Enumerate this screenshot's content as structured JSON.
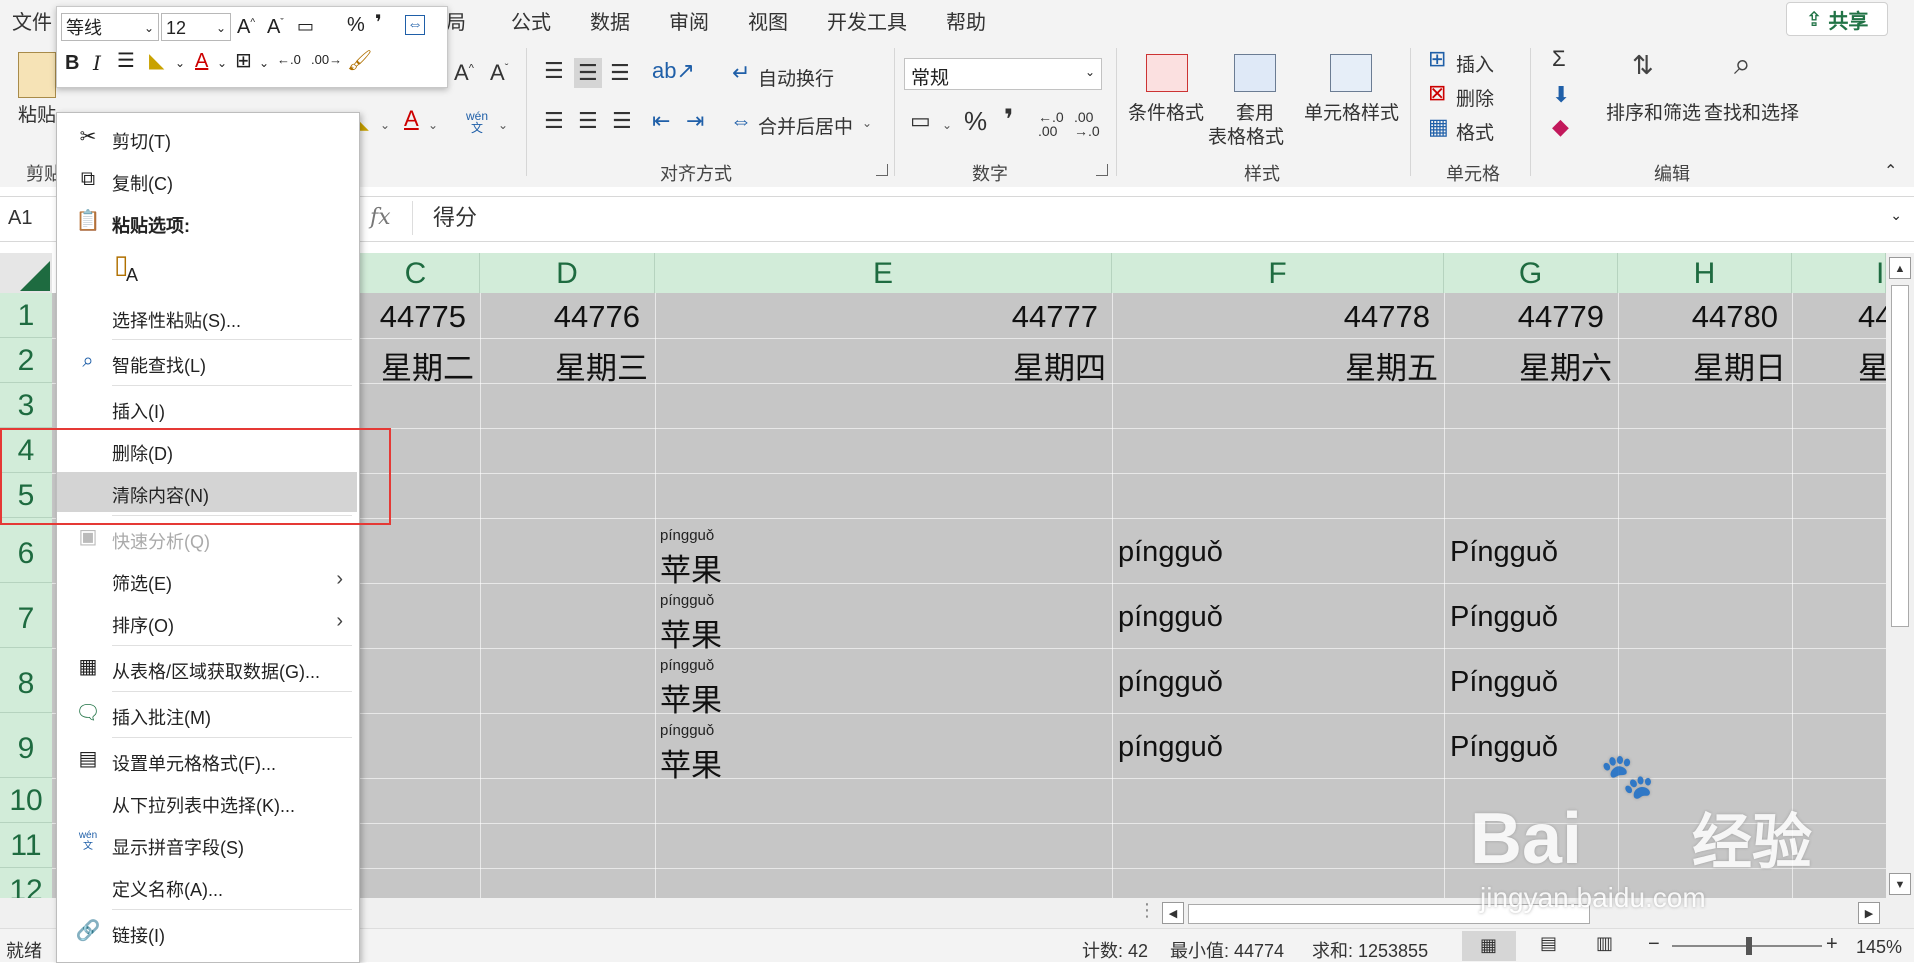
{
  "menubar": {
    "items": [
      "文件",
      "公式",
      "数据",
      "审阅",
      "视图",
      "开发工具",
      "帮助"
    ],
    "partial_item": "局",
    "share_label": "共享"
  },
  "mini_toolbar": {
    "font_name": "等线",
    "font_size": "12",
    "bold": "B",
    "italic": "I"
  },
  "ribbon": {
    "clipboard": {
      "paste_label": "粘贴",
      "group_label": "剪贴"
    },
    "alignment": {
      "wrap_text": "自动换行",
      "merge_center": "合并后居中",
      "group_label": "对齐方式",
      "pinyin_top": "wén",
      "pinyin_bottom": "文"
    },
    "number": {
      "format_value": "常规",
      "group_label": "数字"
    },
    "styles": {
      "conditional": "条件格式",
      "table_fmt_1": "套用",
      "table_fmt_2": "表格格式",
      "cell_styles": "单元格样式",
      "group_label": "样式"
    },
    "cells": {
      "insert": "插入",
      "delete": "删除",
      "format": "格式",
      "group_label": "单元格"
    },
    "editing": {
      "sort_filter": "排序和筛选",
      "find_select": "查找和选择",
      "group_label": "编辑"
    }
  },
  "formula_bar": {
    "name_box": "A1",
    "fx": "fx",
    "content": "得分"
  },
  "columns": [
    "C",
    "D",
    "E",
    "F",
    "G",
    "H",
    "I"
  ],
  "rows": [
    "1",
    "2",
    "3",
    "4",
    "5",
    "6",
    "7",
    "8",
    "9",
    "10",
    "11",
    "12"
  ],
  "cells": {
    "row1": [
      "44775",
      "44776",
      "44777",
      "44778",
      "44779",
      "44780",
      "44"
    ],
    "row2": [
      "星期二",
      "星期三",
      "星期四",
      "星期五",
      "星期六",
      "星期日",
      "星"
    ],
    "pinyin_small": "píngguǒ",
    "hanzi": "苹果",
    "col_f": "píngguǒ",
    "col_g": "Píngguǒ"
  },
  "context_menu": {
    "items": [
      {
        "label": "剪切(T)",
        "icon": "scissors-icon"
      },
      {
        "label": "复制(C)",
        "icon": "copy-icon"
      },
      {
        "label": "粘贴选项:",
        "icon": "paste-icon"
      },
      {
        "label": "选择性粘贴(S)..."
      },
      {
        "label": "智能查找(L)",
        "icon": "smart-lookup-icon"
      },
      {
        "label": "插入(I)"
      },
      {
        "label": "删除(D)"
      },
      {
        "label": "清除内容(N)"
      },
      {
        "label": "快速分析(Q)",
        "icon": "quick-analysis-icon",
        "disabled": true
      },
      {
        "label": "筛选(E)",
        "submenu": true
      },
      {
        "label": "排序(O)",
        "submenu": true
      },
      {
        "label": "从表格/区域获取数据(G)...",
        "icon": "table-icon"
      },
      {
        "label": "插入批注(M)",
        "icon": "comment-icon"
      },
      {
        "label": "设置单元格格式(F)...",
        "icon": "format-cells-icon"
      },
      {
        "label": "从下拉列表中选择(K)..."
      },
      {
        "label": "显示拼音字段(S)",
        "icon": "pinyin-icon"
      },
      {
        "label": "定义名称(A)..."
      },
      {
        "label": "链接(I)",
        "icon": "link-icon"
      }
    ],
    "paste_option_letter": "A",
    "pinyin_icon_top": "wén",
    "pinyin_icon_bottom": "文"
  },
  "status_bar": {
    "mode": "就绪",
    "count": "计数: 42",
    "min": "最小值: 44774",
    "sum": "求和: 1253855",
    "zoom": "145%"
  },
  "watermark": {
    "brand": "Bai",
    "brand_cn": "经验",
    "url": "jingyan.baidu.com"
  },
  "colors": {
    "header_green": "#d2ecd9",
    "header_text": "#1e6b40",
    "selection_gray": "#c6c6c6",
    "highlight_red": "#e53935",
    "brand_green": "#217346"
  }
}
